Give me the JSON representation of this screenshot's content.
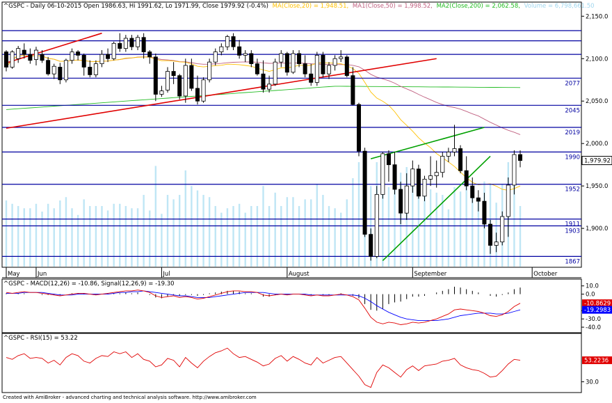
{
  "header": {
    "title": "^GSPC - Daily 06-10-2015 Open 1986.63, Hi 1991.62, Lo 1971.99, Close 1979.92 (-0.4%)",
    "ma20": "MA(Close,20) = 1,948.51,",
    "ma50": "MA1(Close,50) = 1,998.52,",
    "ma200": "MA2(Close,200) = 2,062.58,",
    "volume": "Volume = 6,798,661.50"
  },
  "colors": {
    "up": "#ffffff",
    "down": "#000000",
    "ma20": "#ffc000",
    "ma50": "#c06080",
    "ma200": "#22bb22",
    "volume": "#bfe6f5",
    "hline": "#0000a0",
    "redline": "#e00000",
    "greenline": "#00a000",
    "macd": "#e00000",
    "signal": "#0000ff",
    "rsi": "#e00000"
  },
  "chart_data": [
    {
      "type": "candlestick",
      "title": "^GSPC - Daily 06-10-2015",
      "ylim": [
        1855,
        2165
      ],
      "yticks": [
        1900,
        1950,
        2000,
        2050,
        2100,
        2150
      ],
      "ytick_labels": [
        "1,900.0",
        "1,950.0",
        "2,000.0",
        "2,050.0",
        "2,100.0",
        "2,150.0"
      ],
      "month_labels": [
        {
          "label": "May",
          "index": 0
        },
        {
          "label": "Jun",
          "index": 5
        },
        {
          "label": "Jul",
          "index": 26
        },
        {
          "label": "August",
          "index": 47
        },
        {
          "label": "September",
          "index": 68
        },
        {
          "label": "October",
          "index": 88
        }
      ],
      "last_price_label": "1,979.92",
      "levels": [
        {
          "value": 2133,
          "label": ""
        },
        {
          "value": 2121,
          "label": ""
        },
        {
          "value": 2105,
          "label": ""
        },
        {
          "value": 2077,
          "label": "2077"
        },
        {
          "value": 2045,
          "label": "2045"
        },
        {
          "value": 2019,
          "label": "2019"
        },
        {
          "value": 1990,
          "label": "1990"
        },
        {
          "value": 1952,
          "label": "1952"
        },
        {
          "value": 1911,
          "label": "1911"
        },
        {
          "value": 1903,
          "label": "1903"
        },
        {
          "value": 1867,
          "label": "1867"
        }
      ],
      "trendlines": [
        {
          "color": "red",
          "from": [
            0,
            2095
          ],
          "to": [
            16,
            2130
          ]
        },
        {
          "color": "red",
          "from": [
            0,
            2018
          ],
          "to": [
            72,
            2100
          ]
        },
        {
          "color": "green",
          "from": [
            63,
            1862
          ],
          "to": [
            81,
            1985
          ]
        },
        {
          "color": "green",
          "from": [
            61,
            1982
          ],
          "to": [
            80,
            2019
          ]
        }
      ],
      "candles": [
        [
          2108,
          2110,
          2085,
          2090
        ],
        [
          2090,
          2110,
          2088,
          2108
        ],
        [
          2100,
          2115,
          2095,
          2112
        ],
        [
          2110,
          2118,
          2100,
          2105
        ],
        [
          2105,
          2112,
          2094,
          2098
        ],
        [
          2099,
          2114,
          2092,
          2110
        ],
        [
          2105,
          2110,
          2095,
          2098
        ],
        [
          2098,
          2102,
          2080,
          2082
        ],
        [
          2082,
          2094,
          2076,
          2091
        ],
        [
          2090,
          2095,
          2070,
          2075
        ],
        [
          2075,
          2100,
          2072,
          2098
        ],
        [
          2098,
          2112,
          2094,
          2108
        ],
        [
          2108,
          2110,
          2098,
          2104
        ],
        [
          2104,
          2106,
          2080,
          2090
        ],
        [
          2090,
          2098,
          2078,
          2081
        ],
        [
          2081,
          2098,
          2078,
          2094
        ],
        [
          2094,
          2110,
          2090,
          2105
        ],
        [
          2105,
          2112,
          2096,
          2100
        ],
        [
          2100,
          2120,
          2098,
          2118
        ],
        [
          2118,
          2130,
          2108,
          2112
        ],
        [
          2112,
          2128,
          2108,
          2124
        ],
        [
          2124,
          2128,
          2110,
          2114
        ],
        [
          2114,
          2128,
          2110,
          2125
        ],
        [
          2125,
          2130,
          2100,
          2108
        ],
        [
          2108,
          2110,
          2094,
          2102
        ],
        [
          2102,
          2106,
          2050,
          2058
        ],
        [
          2058,
          2068,
          2055,
          2062
        ],
        [
          2063,
          2090,
          2060,
          2085
        ],
        [
          2085,
          2096,
          2070,
          2080
        ],
        [
          2080,
          2082,
          2052,
          2056
        ],
        [
          2056,
          2100,
          2048,
          2092
        ],
        [
          2092,
          2100,
          2062,
          2065
        ],
        [
          2065,
          2080,
          2046,
          2050
        ],
        [
          2050,
          2078,
          2048,
          2075
        ],
        [
          2075,
          2100,
          2072,
          2096
        ],
        [
          2096,
          2112,
          2092,
          2108
        ],
        [
          2108,
          2118,
          2104,
          2114
        ],
        [
          2114,
          2128,
          2110,
          2126
        ],
        [
          2126,
          2130,
          2110,
          2114
        ],
        [
          2114,
          2122,
          2100,
          2104
        ],
        [
          2104,
          2110,
          2096,
          2106
        ],
        [
          2106,
          2110,
          2090,
          2094
        ],
        [
          2094,
          2100,
          2080,
          2082
        ],
        [
          2082,
          2098,
          2060,
          2064
        ],
        [
          2064,
          2080,
          2060,
          2070
        ],
        [
          2070,
          2100,
          2068,
          2096
        ],
        [
          2096,
          2110,
          2090,
          2106
        ],
        [
          2106,
          2108,
          2080,
          2084
        ],
        [
          2084,
          2110,
          2082,
          2106
        ],
        [
          2106,
          2110,
          2090,
          2094
        ],
        [
          2094,
          2104,
          2078,
          2082
        ],
        [
          2082,
          2094,
          2068,
          2072
        ],
        [
          2072,
          2108,
          2068,
          2104
        ],
        [
          2104,
          2108,
          2078,
          2082
        ],
        [
          2082,
          2096,
          2076,
          2092
        ],
        [
          2092,
          2104,
          2086,
          2100
        ],
        [
          2100,
          2110,
          2096,
          2102
        ],
        [
          2102,
          2104,
          2078,
          2080
        ],
        [
          2080,
          2090,
          2045,
          2046
        ],
        [
          2046,
          2048,
          1985,
          1991
        ],
        [
          1991,
          1995,
          1890,
          1893
        ],
        [
          1893,
          1900,
          1862,
          1867
        ],
        [
          1867,
          1950,
          1865,
          1940
        ],
        [
          1940,
          1990,
          1935,
          1988
        ],
        [
          1988,
          1992,
          1955,
          1975
        ],
        [
          1975,
          1990,
          1940,
          1946
        ],
        [
          1946,
          1955,
          1905,
          1918
        ],
        [
          1918,
          1965,
          1910,
          1950
        ],
        [
          1950,
          1980,
          1942,
          1970
        ],
        [
          1970,
          1975,
          1935,
          1938
        ],
        [
          1938,
          1962,
          1932,
          1958
        ],
        [
          1958,
          1985,
          1950,
          1962
        ],
        [
          1962,
          1980,
          1948,
          1966
        ],
        [
          1966,
          1990,
          1960,
          1985
        ],
        [
          1985,
          1995,
          1978,
          1990
        ],
        [
          1990,
          2022,
          1985,
          1994
        ],
        [
          1994,
          1998,
          1965,
          1968
        ],
        [
          1968,
          1985,
          1945,
          1950
        ],
        [
          1950,
          1960,
          1930,
          1936
        ],
        [
          1936,
          1945,
          1920,
          1932
        ],
        [
          1932,
          1942,
          1900,
          1905
        ],
        [
          1905,
          1910,
          1870,
          1880
        ],
        [
          1880,
          1895,
          1872,
          1884
        ],
        [
          1884,
          1920,
          1880,
          1914
        ],
        [
          1914,
          1960,
          1890,
          1951
        ],
        [
          1951,
          1992,
          1940,
          1987
        ],
        [
          1987,
          1992,
          1972,
          1980
        ]
      ]
    },
    {
      "type": "line",
      "title": "^GSPC - MACD(12,26) = -10.86, Signal(12,26,9) = -19.30",
      "ylim": [
        -45,
        14
      ],
      "yticks": [
        10,
        0,
        -20,
        -30,
        -40
      ],
      "ytick_labels": [
        "10.0",
        "0.0",
        "-20.0",
        "-30.0",
        "-40.0"
      ],
      "value_labels": [
        "-10.8629",
        "-19.2983"
      ],
      "series": [
        {
          "name": "MACD(12,26)",
          "values": [
            2,
            1,
            2,
            3,
            2,
            2,
            1,
            0,
            -1,
            -2,
            -1,
            0,
            1,
            1,
            0,
            -1,
            0,
            1,
            2,
            3,
            4,
            4,
            5,
            4,
            2,
            -2,
            -4,
            -3,
            -2,
            -4,
            -3,
            -4,
            -6,
            -5,
            -3,
            -1,
            1,
            3,
            4,
            4,
            3,
            3,
            2,
            -1,
            -2,
            -1,
            0,
            -1,
            0,
            0,
            -1,
            -2,
            -1,
            -2,
            -2,
            -1,
            0,
            -1,
            -3,
            -7,
            -17,
            -28,
            -34,
            -36,
            -34,
            -35,
            -37,
            -36,
            -34,
            -35,
            -34,
            -32,
            -30,
            -27,
            -24,
            -19,
            -18,
            -19,
            -20,
            -21,
            -23,
            -26,
            -27,
            -25,
            -21,
            -15,
            -11
          ]
        },
        {
          "name": "Signal(12,26,9)",
          "values": [
            1,
            1,
            1,
            2,
            2,
            2,
            2,
            1,
            0,
            -1,
            -1,
            -1,
            0,
            0,
            0,
            0,
            0,
            0,
            1,
            2,
            2,
            3,
            3,
            4,
            3,
            2,
            1,
            0,
            -1,
            -2,
            -2,
            -3,
            -4,
            -4,
            -4,
            -3,
            -2,
            -1,
            0,
            1,
            2,
            2,
            2,
            2,
            1,
            0,
            0,
            0,
            0,
            0,
            0,
            -1,
            -1,
            -1,
            -1,
            -1,
            -1,
            -1,
            -1,
            -2,
            -5,
            -9,
            -14,
            -18,
            -22,
            -25,
            -28,
            -30,
            -31,
            -32,
            -32,
            -32,
            -32,
            -31,
            -30,
            -28,
            -26,
            -25,
            -24,
            -23,
            -23,
            -23,
            -24,
            -24,
            -23,
            -21,
            -19
          ]
        }
      ],
      "histogram": [
        1,
        0,
        1,
        1,
        0,
        0,
        -1,
        -1,
        -1,
        -1,
        0,
        1,
        1,
        1,
        0,
        -1,
        0,
        1,
        1,
        1,
        2,
        1,
        2,
        0,
        -1,
        -4,
        -5,
        -3,
        -1,
        -2,
        -1,
        -1,
        -2,
        -1,
        1,
        2,
        3,
        4,
        4,
        3,
        1,
        1,
        0,
        -3,
        -3,
        -1,
        0,
        -1,
        0,
        0,
        -1,
        -1,
        0,
        -1,
        -1,
        0,
        1,
        0,
        -2,
        -5,
        -12,
        -19,
        -20,
        -18,
        -12,
        -10,
        -9,
        -6,
        -3,
        -3,
        -2,
        0,
        2,
        4,
        6,
        9,
        8,
        6,
        4,
        2,
        0,
        -2,
        -3,
        -1,
        2,
        6,
        8
      ]
    },
    {
      "type": "line",
      "title": "^GSPC - RSI(15) = 53.22",
      "ylim": [
        20,
        75
      ],
      "yticks": [
        30
      ],
      "ytick_labels": [
        "30.0"
      ],
      "value_labels": [
        "53.2236"
      ],
      "series": [
        {
          "name": "RSI(15)",
          "values": [
            56,
            54,
            58,
            60,
            55,
            56,
            55,
            50,
            53,
            48,
            56,
            60,
            58,
            52,
            50,
            55,
            58,
            57,
            62,
            60,
            62,
            56,
            60,
            54,
            52,
            46,
            48,
            55,
            53,
            46,
            56,
            50,
            45,
            52,
            57,
            61,
            63,
            66,
            60,
            56,
            57,
            54,
            51,
            47,
            49,
            55,
            58,
            52,
            57,
            54,
            50,
            48,
            56,
            50,
            53,
            56,
            57,
            50,
            43,
            36,
            27,
            24,
            40,
            48,
            45,
            40,
            35,
            43,
            47,
            42,
            47,
            48,
            49,
            52,
            53,
            55,
            48,
            45,
            43,
            42,
            39,
            35,
            36,
            42,
            49,
            54,
            53
          ]
        }
      ]
    }
  ],
  "footer": {
    "credit": "Created with AmiBroker - advanced charting and technical analysis software. http://www.amibroker.com"
  }
}
